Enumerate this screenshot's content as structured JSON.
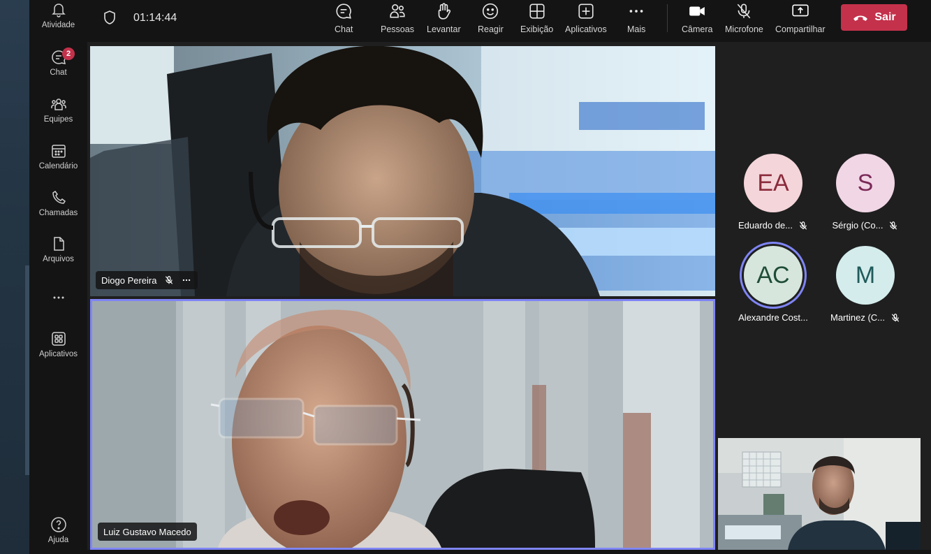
{
  "rail": {
    "items": [
      {
        "label": "Atividade",
        "icon": "bell-icon"
      },
      {
        "label": "Chat",
        "icon": "chat-icon",
        "badge": "2"
      },
      {
        "label": "Equipes",
        "icon": "teams-icon"
      },
      {
        "label": "Calendário",
        "icon": "calendar-icon"
      },
      {
        "label": "Chamadas",
        "icon": "phone-icon"
      },
      {
        "label": "Arquivos",
        "icon": "file-icon"
      },
      {
        "label": "",
        "icon": "more-icon"
      },
      {
        "label": "Aplicativos",
        "icon": "apps-icon"
      }
    ],
    "help_label": "Ajuda"
  },
  "meeting": {
    "timer": "01:14:44"
  },
  "toolbar": {
    "chat": "Chat",
    "people": "Pessoas",
    "raise": "Levantar",
    "react": "Reagir",
    "view": "Exibição",
    "apps": "Aplicativos",
    "more": "Mais",
    "camera": "Câmera",
    "mic": "Microfone",
    "share": "Compartilhar",
    "leave": "Sair"
  },
  "videos": {
    "top": {
      "name": "Diogo Pereira"
    },
    "bottom": {
      "name": "Luiz Gustavo Macedo"
    }
  },
  "gallery": [
    {
      "initials": "EA",
      "name": "Eduardo de...",
      "bg": "#f4d5da",
      "fg": "#8a2b3b",
      "muted": true
    },
    {
      "initials": "S",
      "name": "Sérgio (Co...",
      "bg": "#f1d6e6",
      "fg": "#7a2a57",
      "muted": true
    },
    {
      "initials": "AC",
      "name": "Alexandre Cost...",
      "bg": "#d6e6dd",
      "fg": "#1f4d36",
      "muted": false
    },
    {
      "initials": "M",
      "name": "Martinez (C...",
      "bg": "#d4ecec",
      "fg": "#1f5a5a",
      "muted": true
    }
  ],
  "colors": {
    "accent": "#7f85f5",
    "leave": "#c4314b",
    "badge": "#c4314b"
  }
}
